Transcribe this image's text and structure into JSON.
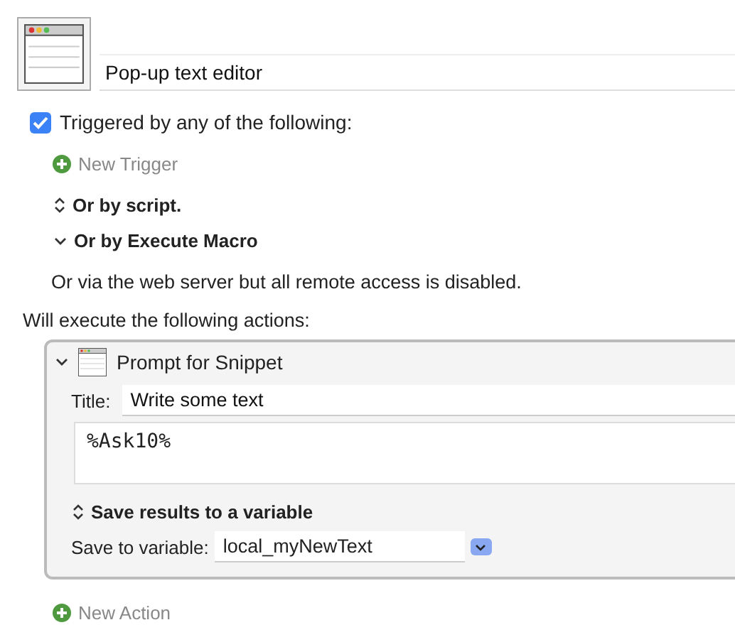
{
  "macro": {
    "name": "Pop-up text editor"
  },
  "trigger_group": {
    "label": "Triggered by any of the following:",
    "checked": true
  },
  "new_trigger": "New Trigger",
  "trigger_sections": [
    {
      "label": "Or by script.",
      "expanded": false
    },
    {
      "label": "Or by Execute Macro",
      "expanded": true
    }
  ],
  "web_note": "Or via the web server but all remote access is disabled.",
  "actions_heading": "Will execute the following actions:",
  "action": {
    "expanded": true,
    "title": "Prompt for Snippet",
    "title_label": "Title:",
    "title_value": "Write some text",
    "text": "%Ask10%",
    "save_section": {
      "label": "Save results to a variable",
      "expanded": false
    },
    "save_label": "Save to variable:",
    "variable": "local_myNewText"
  },
  "new_action": "New Action"
}
